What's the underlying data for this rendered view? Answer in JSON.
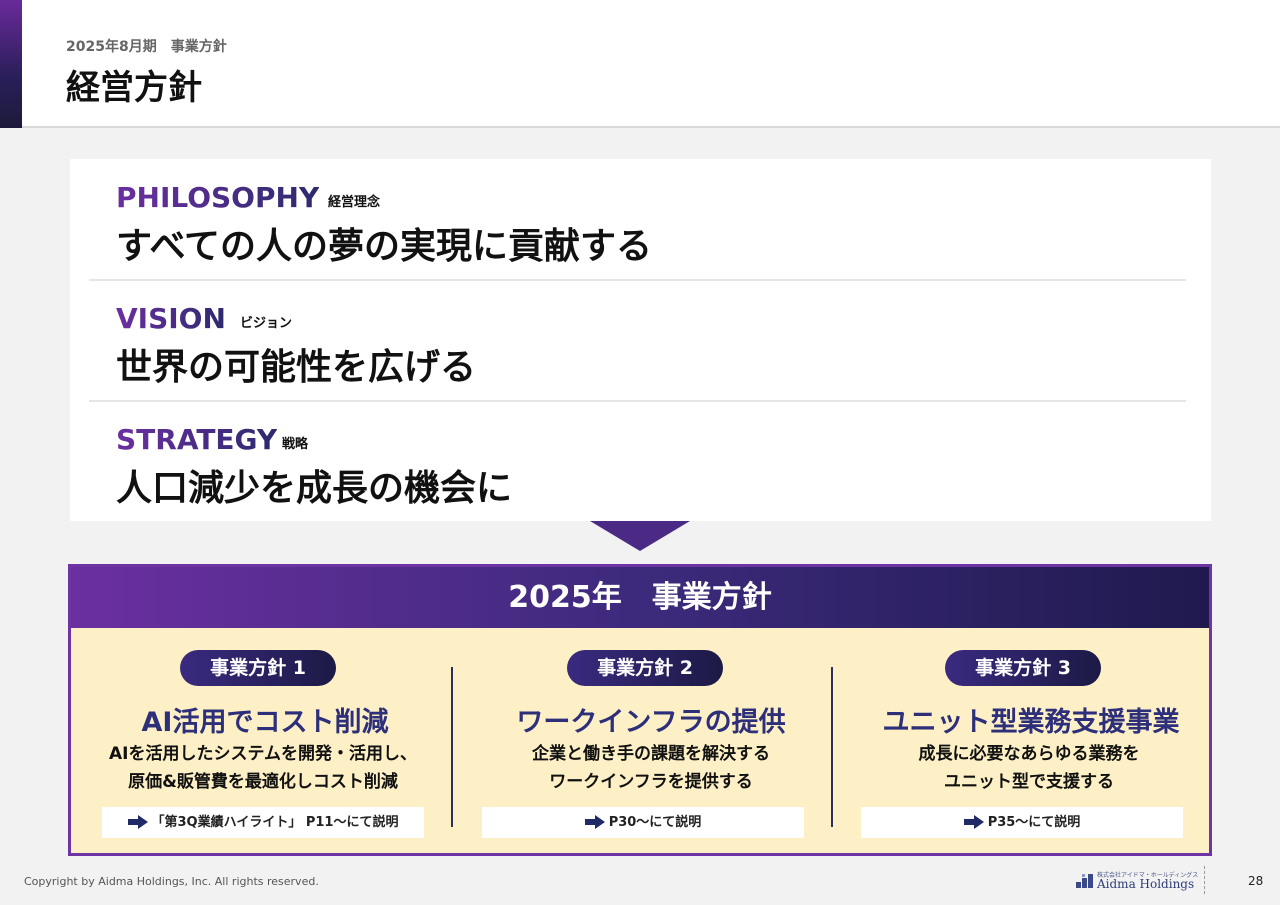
{
  "header": {
    "subtitle": "2025年8月期　事業方針",
    "title": "経営方針"
  },
  "sections": [
    {
      "keyword": "PHILOSOPHY",
      "keyword_jp": "経営理念",
      "statement": "すべての人の夢の実現に貢献する"
    },
    {
      "keyword": "VISION",
      "keyword_jp": "ビジョン",
      "statement": "世界の可能性を広げる"
    },
    {
      "keyword": "STRATEGY",
      "keyword_jp": "戦略",
      "statement": "人口減少を成長の機会に"
    }
  ],
  "policy": {
    "heading": "2025年　事業方針",
    "columns": [
      {
        "pill": "事業方針 1",
        "title": "AI活用でコスト削減",
        "desc_line1": "AIを活用したシステムを開発・活用し、",
        "desc_line2": "原価&販管費を最適化しコスト削減",
        "ref": "「第3Q業績ハイライト」 P11～にて説明"
      },
      {
        "pill": "事業方針 2",
        "title": "ワークインフラの提供",
        "desc_line1": "企業と働き手の課題を解決する",
        "desc_line2": "ワークインフラを提供する",
        "ref": "P30～にて説明"
      },
      {
        "pill": "事業方針 3",
        "title": "ユニット型業務支援事業",
        "desc_line1": "成長に必要なあらゆる業務を",
        "desc_line2": "ユニット型で支援する",
        "ref": "P35～にて説明"
      }
    ]
  },
  "footer": {
    "copyright": "Copyright by Aidma Holdings, Inc. All rights reserved.",
    "logo_small": "株式会社アイドマ・ホールディングス",
    "logo_name": "Aidma Holdings",
    "page_number": "28"
  },
  "colors": {
    "accent_purple": "#6b2fa0",
    "accent_navy": "#1f1a4e",
    "policy_bg": "#fdf0c6",
    "title_blue": "#2d2f7a"
  }
}
